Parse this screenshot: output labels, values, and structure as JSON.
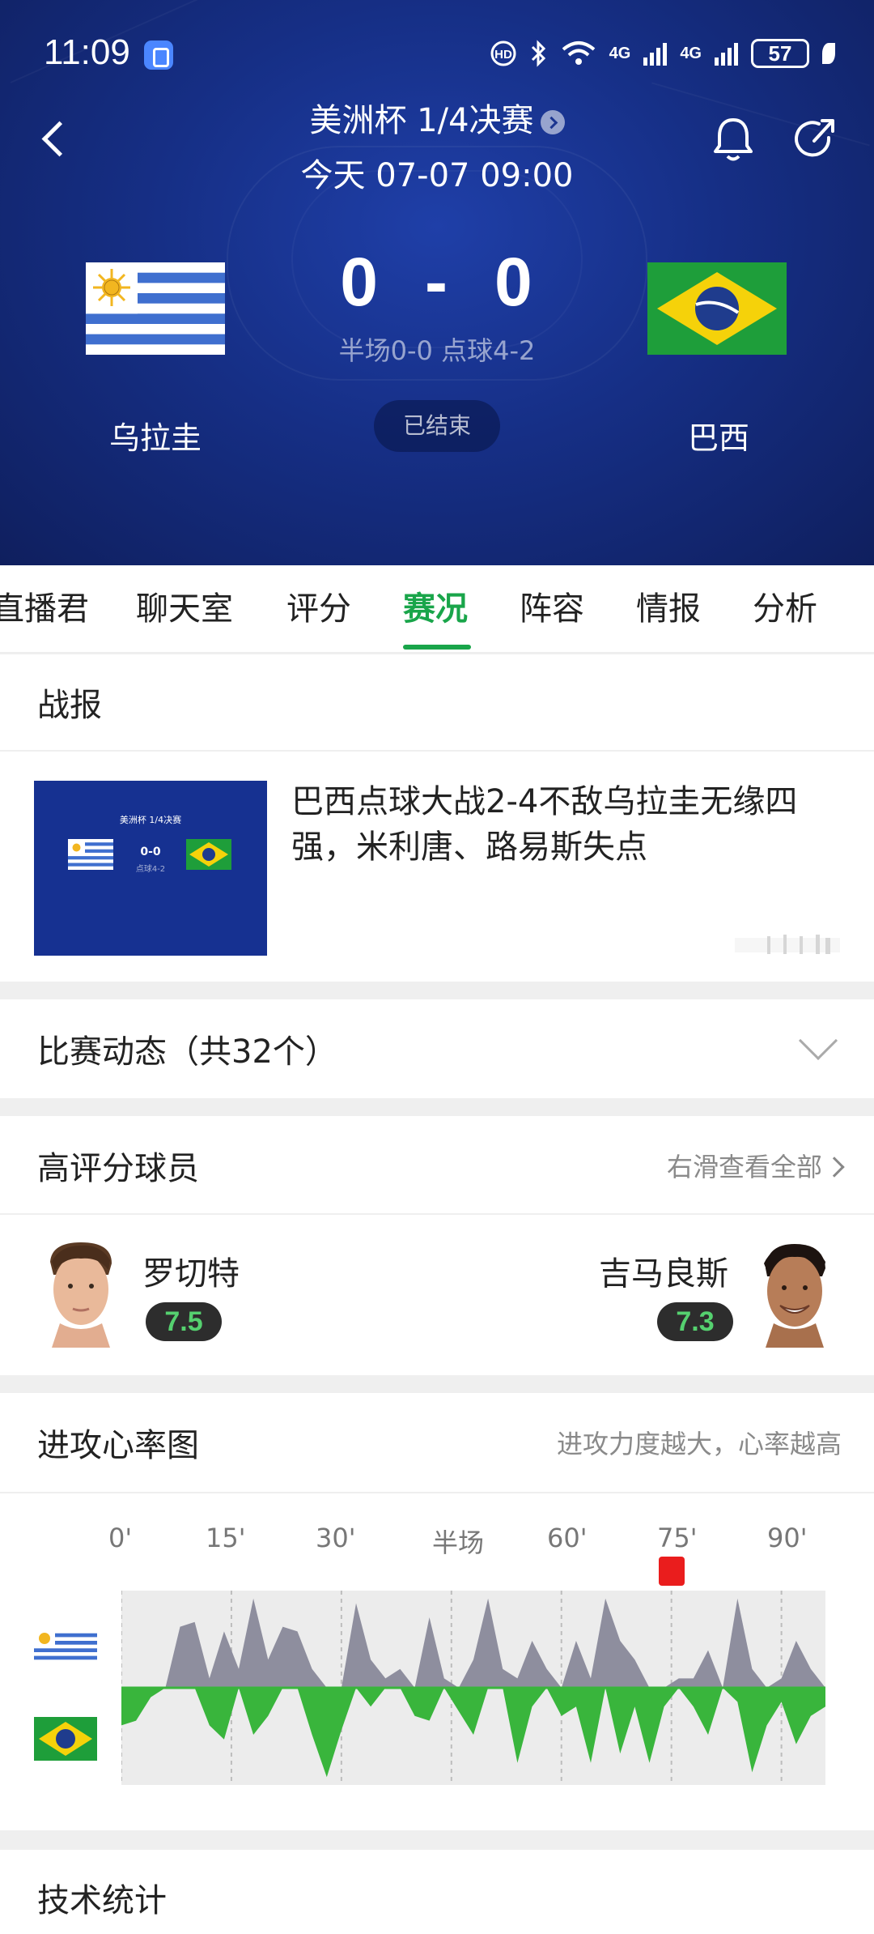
{
  "status_bar": {
    "time": "11:09",
    "battery": "57",
    "network_1": "4G",
    "network_2": "4G",
    "app_icon": "app-notification-icon",
    "icons": [
      "hd-icon",
      "bluetooth-icon",
      "wifi-icon",
      "signal-icon",
      "battery-icon",
      "leaf-icon"
    ]
  },
  "header": {
    "competition": "美洲杯 1/4决赛",
    "datetime": "今天 07-07 09:00",
    "home_team": "乌拉圭",
    "away_team": "巴西",
    "home_score": "0",
    "score_separator": "-",
    "away_score": "0",
    "score_detail": "半场0-0 点球4-2",
    "match_status": "已结束",
    "icons": {
      "back": "chevron-left-icon",
      "bell": "bell-icon",
      "share": "share-icon"
    }
  },
  "tabs": [
    {
      "label": "直播君"
    },
    {
      "label": "聊天室"
    },
    {
      "label": "评分"
    },
    {
      "label": "赛况",
      "active": true
    },
    {
      "label": "阵容"
    },
    {
      "label": "情报"
    },
    {
      "label": "分析"
    }
  ],
  "report": {
    "section_title": "战报",
    "thumbnail": {
      "competition": "美洲杯 1/4决赛",
      "score": "0-0",
      "penalties": "点球4-2"
    },
    "headline": "巴西点球大战2-4不敌乌拉圭无缘四强，米利唐、路易斯失点"
  },
  "events": {
    "title": "比赛动态（共32个）"
  },
  "top_players": {
    "title": "高评分球员",
    "more_label": "右滑查看全部",
    "home": {
      "name": "罗切特",
      "rating": "7.5"
    },
    "away": {
      "name": "吉马良斯",
      "rating": "7.3"
    }
  },
  "heart_rate": {
    "title": "进攻心率图",
    "note": "进攻力度越大，心率越高",
    "ticks": [
      "0'",
      "15'",
      "30'",
      "半场",
      "60'",
      "75'",
      "90'"
    ]
  },
  "tech_stats": {
    "title": "技术统计"
  },
  "chart_data": {
    "type": "area",
    "x": [
      0,
      2,
      4,
      6,
      8,
      10,
      12,
      14,
      16,
      18,
      20,
      22,
      24,
      26,
      28,
      30,
      32,
      34,
      36,
      38,
      40,
      42,
      44,
      46,
      48,
      50,
      52,
      54,
      56,
      58,
      60,
      62,
      64,
      66,
      68,
      70,
      72,
      74,
      76,
      78,
      80,
      82,
      84,
      86,
      88,
      90,
      92,
      94,
      96
    ],
    "series": [
      {
        "name": "乌拉圭",
        "color": "#8e8e9e",
        "values": [
          0,
          0,
          0,
          0,
          0.65,
          0.7,
          0.1,
          0.6,
          0.2,
          0.95,
          0.3,
          0.65,
          0.6,
          0.2,
          0,
          0,
          0.9,
          0.3,
          0.1,
          0.2,
          0,
          0.75,
          0.1,
          0,
          0.3,
          0.95,
          0.2,
          0.1,
          0.5,
          0.2,
          0,
          0.5,
          0.1,
          0.95,
          0.5,
          0.3,
          0,
          0,
          0.1,
          0.1,
          0.4,
          0,
          0.95,
          0.2,
          0,
          0.1,
          0.5,
          0.2,
          0
        ]
      },
      {
        "name": "巴西",
        "color": "#39b53c",
        "values": [
          0.4,
          0.35,
          0.1,
          0,
          0,
          0,
          0.4,
          0.55,
          0,
          0.5,
          0.3,
          0,
          0,
          0.5,
          0.95,
          0.45,
          0,
          0.2,
          0,
          0,
          0.3,
          0.35,
          0,
          0.25,
          0.5,
          0,
          0,
          0.8,
          0.2,
          0,
          0.3,
          0.2,
          0.8,
          0,
          0.7,
          0.2,
          0.8,
          0.2,
          0,
          0.2,
          0.5,
          0,
          0.15,
          0.9,
          0.4,
          0.15,
          0.6,
          0.3,
          0.2
        ]
      }
    ],
    "xlim": [
      0,
      96
    ],
    "ylim": [
      -1,
      1
    ],
    "marker_minute": 75
  }
}
